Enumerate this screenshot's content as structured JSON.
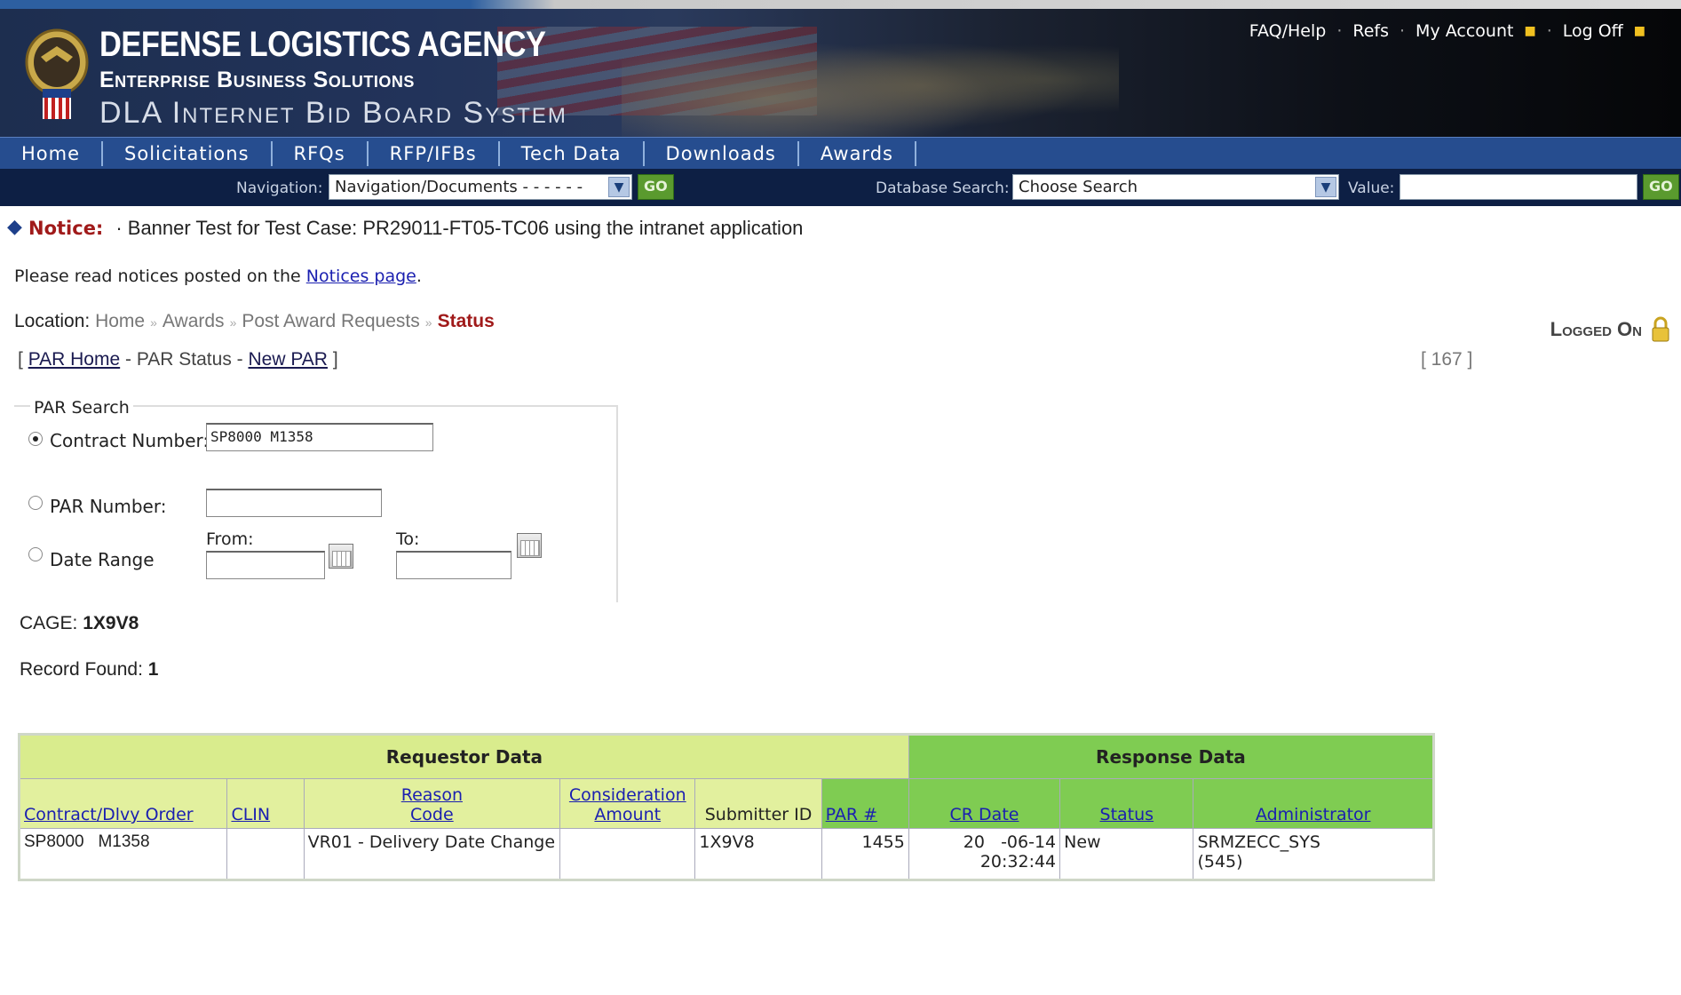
{
  "header": {
    "agency": "DEFENSE LOGISTICS AGENCY",
    "subtitle": "Enterprise Business Solutions",
    "system": "DLA Internet Bid Board System",
    "util_links": [
      "FAQ/Help",
      "Refs",
      "My Account",
      "Log Off"
    ]
  },
  "nav": {
    "items": [
      "Home",
      "Solicitations",
      "RFQs",
      "RFP/IFBs",
      "Tech Data",
      "Downloads",
      "Awards"
    ]
  },
  "toolbar": {
    "navigation_label": "Navigation:",
    "navigation_value": "Navigation/Documents - - - - - -",
    "go1": "GO",
    "db_search_label": "Database Search:",
    "db_search_value": "Choose Search",
    "value_label": "Value:",
    "go2": "GO"
  },
  "notice": {
    "label": "Notice:",
    "text": "· Banner Test for Test Case: PR29011-FT05-TC06 using the intranet application"
  },
  "read_notices": {
    "prefix": "Please read notices posted on the ",
    "link": "Notices page",
    "suffix": "."
  },
  "location": {
    "label": "Location:",
    "crumbs": [
      "Home",
      "Awards",
      "Post Award Requests"
    ],
    "current": "Status"
  },
  "logged_on": "Logged On",
  "par_links": {
    "open": "[",
    "home": "PAR Home",
    "sep1": " - PAR Status - ",
    "new": "New PAR",
    "close": "]"
  },
  "counter": "[ 167 ]",
  "par_search": {
    "legend": "PAR Search",
    "contract_label": "Contract Number:",
    "contract_value": "SP8000   M1358",
    "par_label": "PAR Number:",
    "par_value": "",
    "date_label": "Date Range",
    "from_label": "From:",
    "to_label": "To:"
  },
  "cage": {
    "label": "CAGE:",
    "value": "1X9V8"
  },
  "records": {
    "label": "Record Found:",
    "value": "1"
  },
  "table": {
    "group_requestor": "Requestor Data",
    "group_response": "Response Data",
    "headers": {
      "contract": "Contract/Dlvy Order",
      "clin": "CLIN",
      "reason1": "Reason",
      "reason2": "Code",
      "consid1": "Consideration",
      "consid2": "Amount",
      "submitter": "Submitter ID",
      "par": "PAR #",
      "crdate": "CR Date",
      "status": "Status",
      "admin": "Administrator"
    },
    "row": {
      "contract": "SP8000   M1358",
      "clin": "",
      "reason": "VR01 - Delivery Date Change",
      "consideration": "",
      "submitter": "1X9V8",
      "par": "1455",
      "crdate1": "20   -06-14",
      "crdate2": "20:32:44",
      "status": "New",
      "admin1": "SRMZECC_SYS",
      "admin2": "(545)"
    }
  }
}
